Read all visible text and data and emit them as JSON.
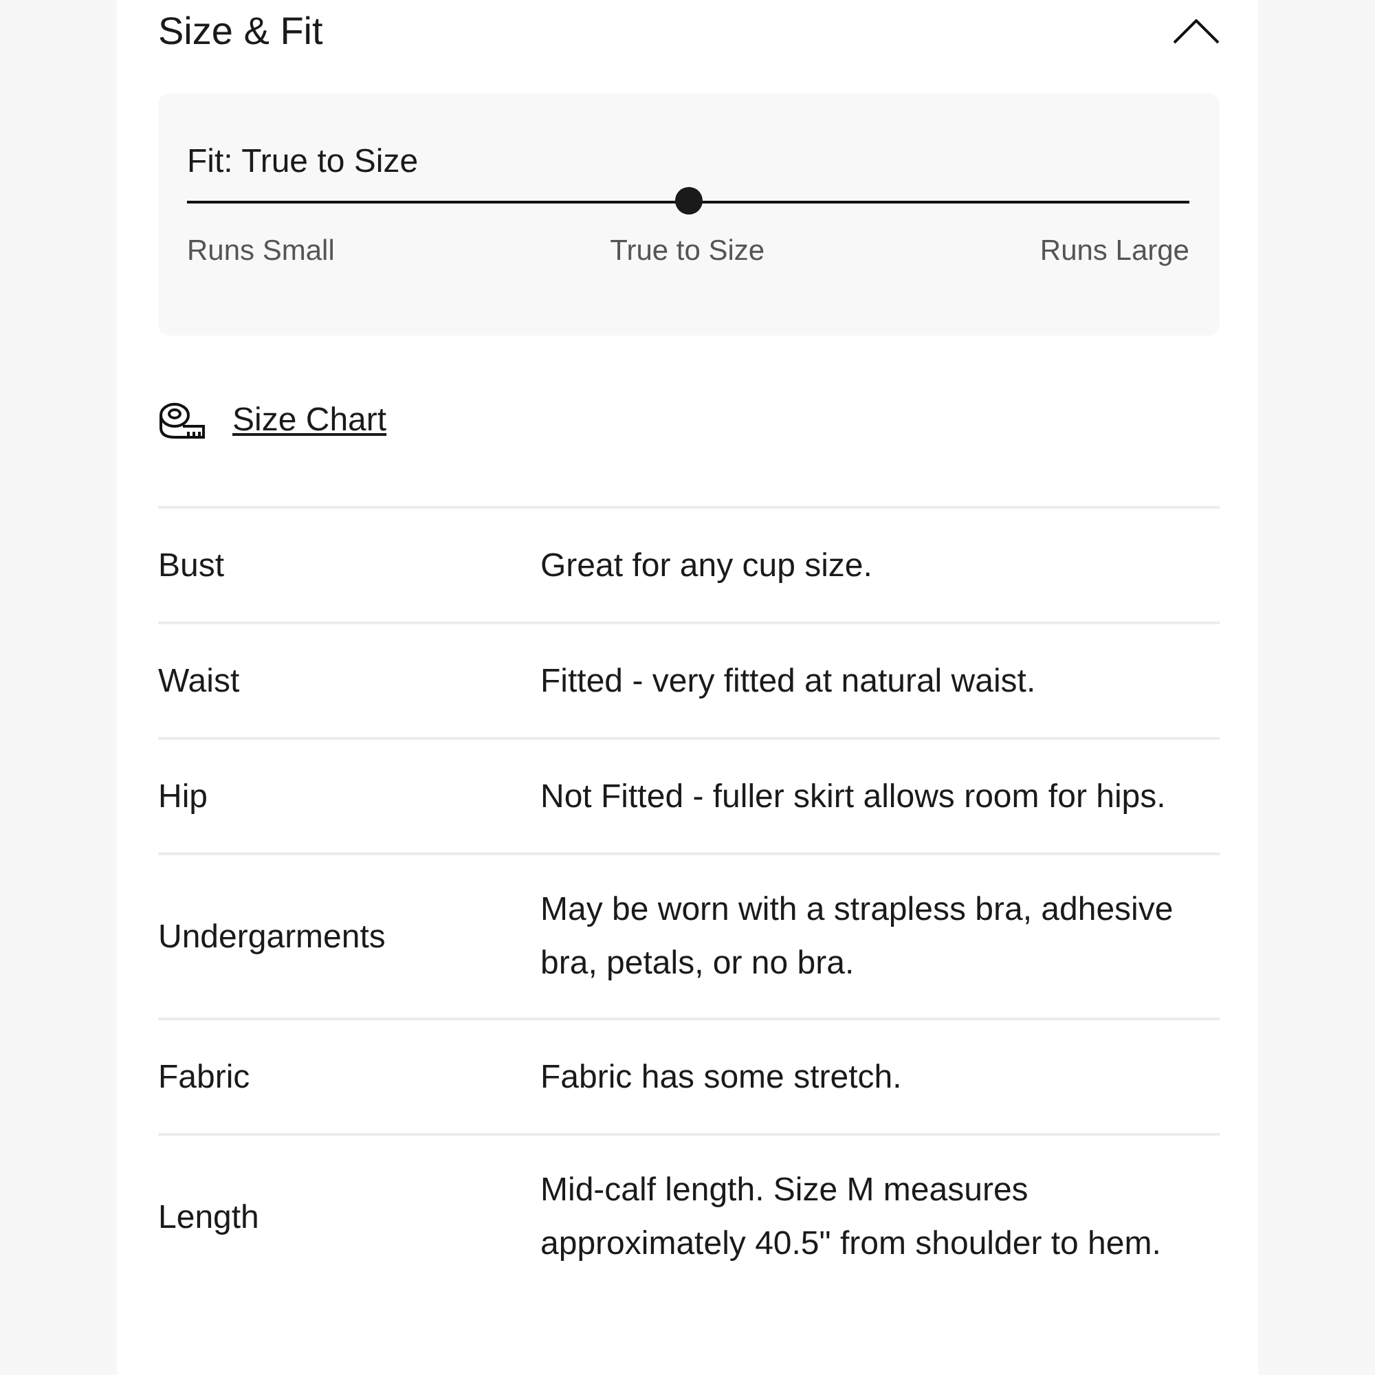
{
  "section": {
    "title": "Size & Fit",
    "expanded": true
  },
  "fit": {
    "title": "Fit: True to Size",
    "level": 0.5,
    "labels": [
      "Runs Small",
      "True to Size",
      "Runs Large"
    ]
  },
  "size_chart_link": "Size Chart",
  "details": [
    {
      "label": "Bust",
      "value": "Great for any cup size."
    },
    {
      "label": "Waist",
      "value": "Fitted - very fitted at natural waist."
    },
    {
      "label": "Hip",
      "value": "Not Fitted - fuller skirt allows room for hips."
    },
    {
      "label": "Undergarments",
      "value": "May be worn with a strapless bra, adhesive bra, petals, or no bra."
    },
    {
      "label": "Fabric",
      "value": "Fabric has some stretch."
    },
    {
      "label": "Length",
      "value": "Mid-calf length. Size M measures approximately 40.5\" from shoulder to hem."
    }
  ]
}
